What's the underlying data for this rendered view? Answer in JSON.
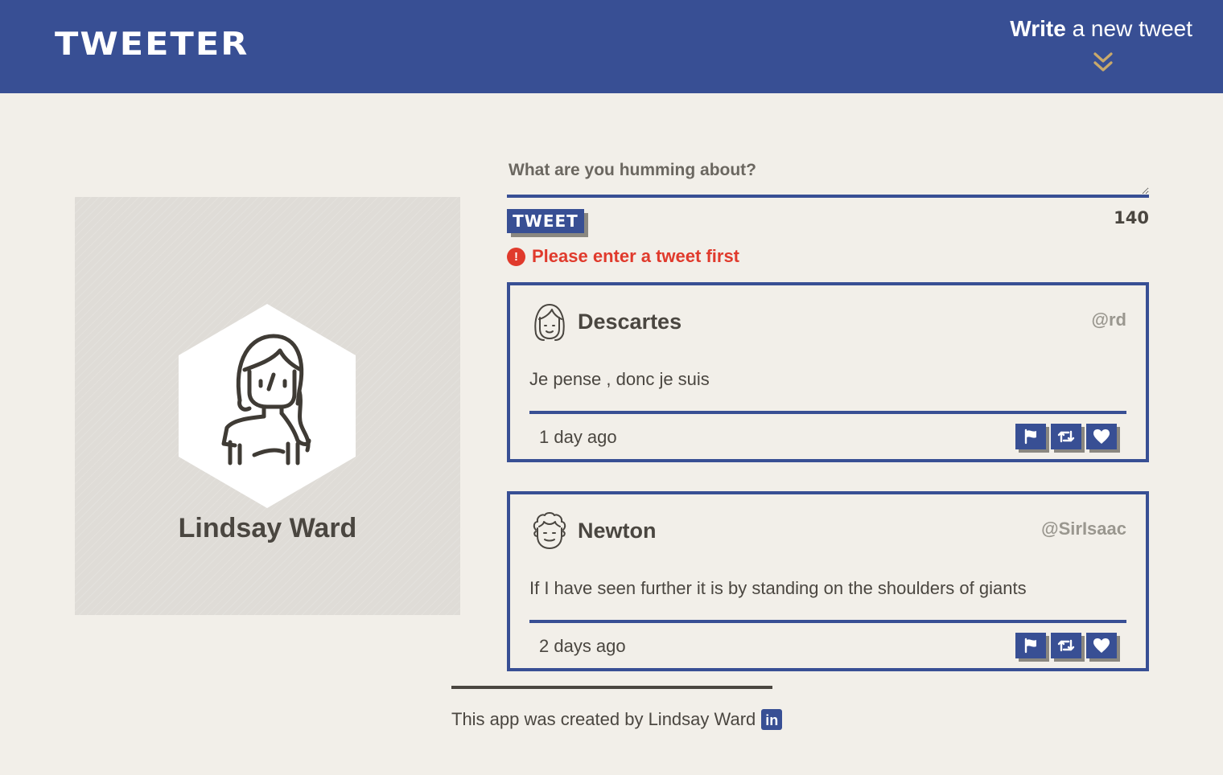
{
  "nav": {
    "brand": "TWEETER",
    "compose_toggle_bold": "Write",
    "compose_toggle_rest": " a new tweet",
    "chevron_icon": "double-chevron-down-icon",
    "accent_color": "#384f94",
    "chevron_color": "#c9a96b"
  },
  "profile": {
    "name": "Lindsay Ward",
    "avatar_icon": "woman-avatar-icon"
  },
  "compose": {
    "label": "What are you humming about?",
    "placeholder": "",
    "value": "",
    "button_label": "TWEET",
    "counter": "140",
    "error_icon": "!",
    "error_message": "Please enter a tweet first",
    "error_color": "#e03a2c"
  },
  "tweets": [
    {
      "author": "Descartes",
      "handle": "@rd",
      "text": "Je pense , donc je suis",
      "time": "1 day ago",
      "avatar_icon": "girl-face-avatar-icon"
    },
    {
      "author": "Newton",
      "handle": "@SirIsaac",
      "text": "If I have seen further it is by standing on the shoulders of giants",
      "time": "2 days ago",
      "avatar_icon": "curly-hair-face-avatar-icon"
    }
  ],
  "footer": {
    "credit": "This app was created by Lindsay Ward",
    "linkedin_label": "in"
  }
}
